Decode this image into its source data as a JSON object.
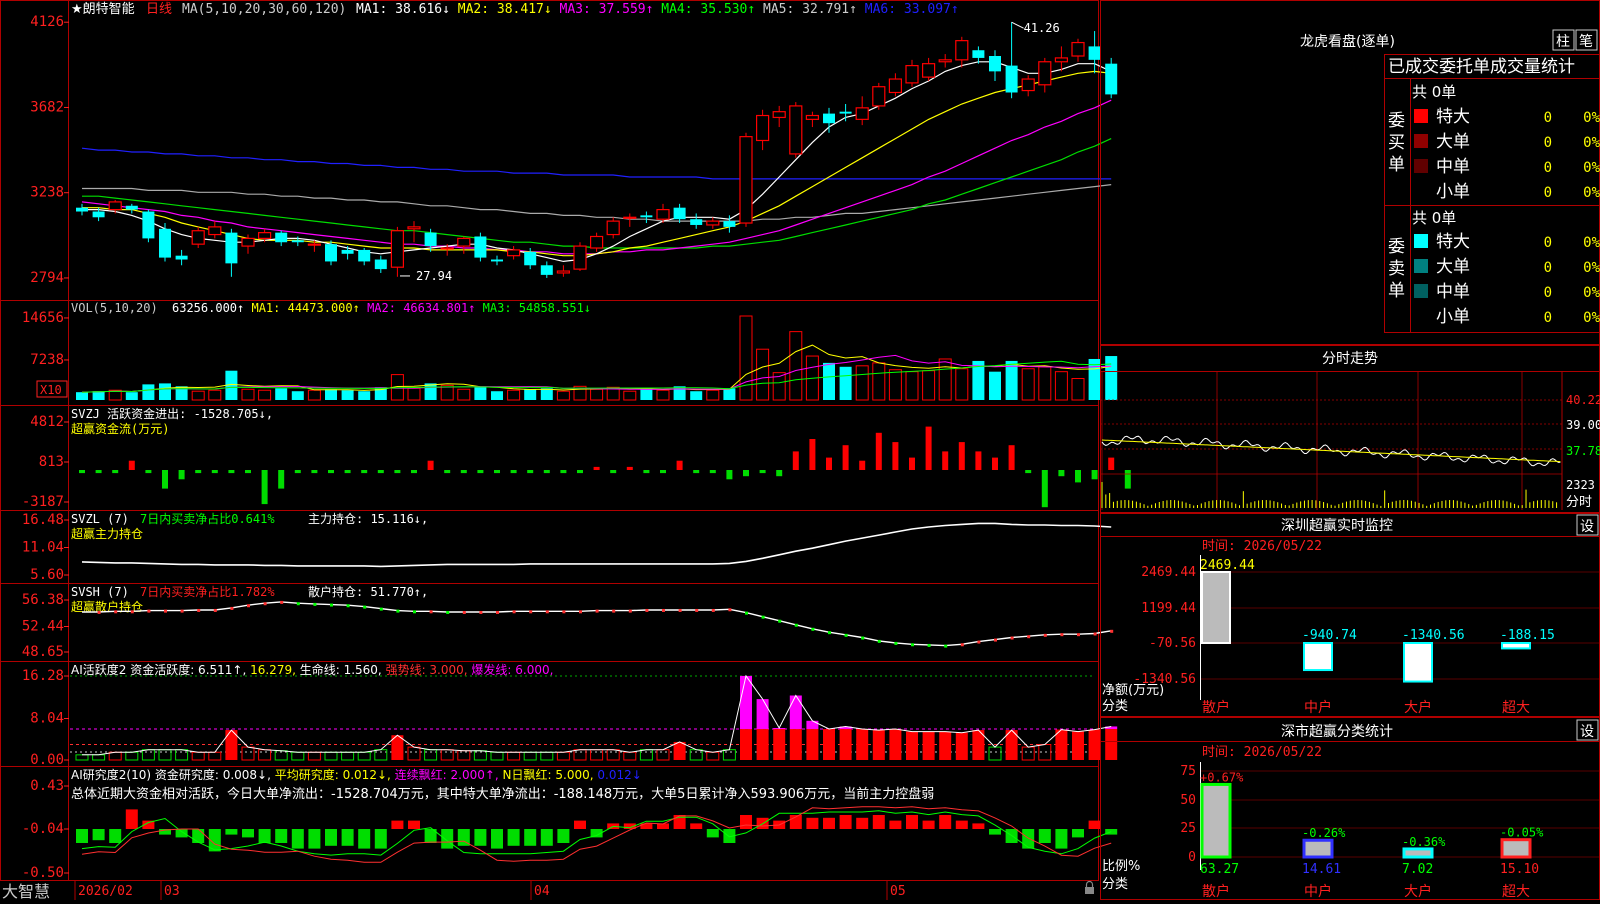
{
  "header": {
    "stock_name": "★朗特智能",
    "period": "日线",
    "ma_label": "MA(5,10,20,30,60,120)",
    "ma": [
      {
        "text": "MA1: 38.616↓",
        "color": "#ffffff"
      },
      {
        "text": "MA2: 38.417↓",
        "color": "#ffff00"
      },
      {
        "text": "MA3: 37.559↑",
        "color": "#ff00ff"
      },
      {
        "text": "MA4: 35.530↑",
        "color": "#00ff00"
      },
      {
        "text": "MA5: 32.791↑",
        "color": "#cccccc"
      },
      {
        "text": "MA6: 33.097↑",
        "color": "#2020ff"
      }
    ],
    "high_label": "41.26",
    "low_label": "27.94"
  },
  "price_axis": [
    "4126",
    "3682",
    "3238",
    "2794"
  ],
  "vol_panel": {
    "title": "VOL(5,10,20)",
    "items": [
      {
        "text": "63256.000↑",
        "color": "#ffffff"
      },
      {
        "text": "MA1: 44473.000↑",
        "color": "#ffff00"
      },
      {
        "text": "MA2: 46634.801↑",
        "color": "#ff00ff"
      },
      {
        "text": "MA3: 54858.551↓",
        "color": "#00ff00"
      }
    ],
    "axis": [
      "14656",
      "7238"
    ],
    "unit": "X10"
  },
  "svzj_panel": {
    "line1": "SVZJ  活跃资金进出: -1528.705↓,",
    "line2": "超赢资金流(万元)",
    "axis": [
      "4812",
      "813",
      "-3187"
    ]
  },
  "svzl_panel": {
    "line1_a": "SVZL (7)",
    "line1_b": "7日内买卖净占比0.641%",
    "line1_c": "主力持仓: 15.116↓,",
    "line2": "超赢主力持仓",
    "axis": [
      "16.48",
      "11.04",
      "5.60"
    ]
  },
  "svsh_panel": {
    "line1_a": "SVSH (7)",
    "line1_b": "7日内买卖净占比1.782%",
    "line1_c": "散户持仓: 51.770↑,",
    "line2": "超赢散户持仓",
    "axis": [
      "56.38",
      "52.44",
      "48.65"
    ]
  },
  "ai_active_panel": {
    "items": [
      {
        "text": "AI活跃度2 资金活跃度: 6.511↑,",
        "color": "#ffffff"
      },
      {
        "text": "16.279,",
        "color": "#ffff00"
      },
      {
        "text": "生命线: 1.560,",
        "color": "#ffffff"
      },
      {
        "text": "强势线: 3.000,",
        "color": "#ff3030"
      },
      {
        "text": "爆发线: 6.000,",
        "color": "#ff00ff"
      }
    ],
    "axis": [
      "16.28",
      "8.04",
      "0.00"
    ]
  },
  "ai_research_panel": {
    "items": [
      {
        "text": "AI研究度2(10) 资金研究度: 0.008↓,",
        "color": "#ffffff"
      },
      {
        "text": "平均研究度: 0.012↓,",
        "color": "#ffff00"
      },
      {
        "text": "连续飘红: 2.000↑,",
        "color": "#ff00ff"
      },
      {
        "text": "N日飘红: 5.000,",
        "color": "#ffff00"
      },
      {
        "text": "0.012↓",
        "color": "#2020ff"
      }
    ],
    "summary": "总体近期大资金相对活跃，今日大单净流出：-1528.704万元，其中特大单净流出：-188.148万元，大单5日累计净入593.906万元，当前主力控盘弱",
    "axis": [
      "0.43",
      "-0.04",
      "-0.50"
    ]
  },
  "bottom_bar": {
    "brand": "大智慧",
    "date_labels": [
      "2026/02",
      "03",
      "04",
      "05"
    ]
  },
  "dragon_tiger": {
    "title": "龙虎看盘(逐单)",
    "btn1": "柱",
    "btn2": "笔",
    "subtitle": "已成交委托单成交量统计",
    "buy_label": "委买单",
    "sell_label": "委卖单",
    "buy_total": "共 0单",
    "sell_total": "共 0单",
    "buy_rows": [
      {
        "label": "特大",
        "count": "0",
        "pct": "0%",
        "color": "#ff0000"
      },
      {
        "label": "大单",
        "count": "0",
        "pct": "0%",
        "color": "#900000"
      },
      {
        "label": "中单",
        "count": "0",
        "pct": "0%",
        "color": "#600000"
      },
      {
        "label": "小单",
        "count": "0",
        "pct": "0%",
        "color": ""
      }
    ],
    "sell_rows": [
      {
        "label": "特大",
        "count": "0",
        "pct": "0%",
        "color": "#00ffff"
      },
      {
        "label": "大单",
        "count": "0",
        "pct": "0%",
        "color": "#008080"
      },
      {
        "label": "中单",
        "count": "0",
        "pct": "0%",
        "color": "#006060"
      },
      {
        "label": "小单",
        "count": "0",
        "pct": "0%",
        "color": ""
      }
    ]
  },
  "intraday": {
    "title": "分时走势",
    "axis": [
      "40.22",
      "39.00",
      "37.78"
    ],
    "vol_label": "2323",
    "bottom_label": "分时"
  },
  "realtime_monitor": {
    "title": "深圳超赢实时监控",
    "settings": "设",
    "time": "时间: 2026/05/22",
    "axis": [
      "2469.44",
      "1199.44",
      "-70.56",
      "-1340.56"
    ],
    "ylabel1": "净额(万元)",
    "ylabel2": "分类",
    "categories": [
      "散户",
      "中户",
      "大户",
      "超大"
    ],
    "values": [
      2469.44,
      -940.74,
      -1340.56,
      -188.15
    ],
    "value_labels": [
      "2469.44",
      "-940.74",
      "-1340.56",
      "-188.15"
    ]
  },
  "class_stats": {
    "title": "深市超赢分类统计",
    "settings": "设",
    "time": "时间: 2026/05/22",
    "axis": [
      "75",
      "50",
      "25",
      "0"
    ],
    "ylabel1": "比例%",
    "ylabel2": "分类",
    "categories": [
      "散户",
      "中户",
      "大户",
      "超大"
    ],
    "values": [
      63.27,
      14.61,
      7.02,
      15.1
    ],
    "value_labels": [
      "63.27",
      "14.61",
      "7.02",
      "15.10"
    ],
    "change_labels": [
      "+0.67%",
      "-0.26%",
      "-0.36%",
      "-0.05%"
    ]
  },
  "colors": {
    "up": "#ff0000",
    "down": "#00ffff",
    "frame": "#b00000",
    "flow_up": "#ff0000",
    "flow_down": "#00dd00"
  },
  "chart_data": {
    "type": "candlestick",
    "x": [
      "2026/02",
      "03",
      "04",
      "05"
    ],
    "candles": [
      [
        31.6,
        31.4,
        31.8,
        31.2
      ],
      [
        31.4,
        31.1,
        31.6,
        30.9
      ],
      [
        31.5,
        31.9,
        32.0,
        31.3
      ],
      [
        31.7,
        31.5,
        31.8,
        31.3
      ],
      [
        31.4,
        30.0,
        31.5,
        29.8
      ],
      [
        30.5,
        29.0,
        30.8,
        28.8
      ],
      [
        29.1,
        28.9,
        29.4,
        28.6
      ],
      [
        29.7,
        30.4,
        30.6,
        29.5
      ],
      [
        30.2,
        30.6,
        30.9,
        30.0
      ],
      [
        30.3,
        28.7,
        30.5,
        28.0
      ],
      [
        29.6,
        30.0,
        30.2,
        29.2
      ],
      [
        30.0,
        30.3,
        30.5,
        29.8
      ],
      [
        30.3,
        29.8,
        30.4,
        29.6
      ],
      [
        29.9,
        29.8,
        30.1,
        29.6
      ],
      [
        29.7,
        29.7,
        29.9,
        29.3
      ],
      [
        29.7,
        28.8,
        29.9,
        28.6
      ],
      [
        29.4,
        29.2,
        29.6,
        28.9
      ],
      [
        29.4,
        28.8,
        29.5,
        28.6
      ],
      [
        28.9,
        28.4,
        29.1,
        28.2
      ],
      [
        28.5,
        30.4,
        30.6,
        28.0
      ],
      [
        30.5,
        30.6,
        30.9,
        29.8
      ],
      [
        30.3,
        29.6,
        30.5,
        29.3
      ],
      [
        29.5,
        29.5,
        29.7,
        29.1
      ],
      [
        29.6,
        30.0,
        30.1,
        29.2
      ],
      [
        30.1,
        29.0,
        30.3,
        28.8
      ],
      [
        28.9,
        28.8,
        29.1,
        28.6
      ],
      [
        29.1,
        29.4,
        29.6,
        28.9
      ],
      [
        29.3,
        28.6,
        29.5,
        28.4
      ],
      [
        28.6,
        28.1,
        28.8,
        27.94
      ],
      [
        28.2,
        28.3,
        28.6,
        28.0
      ],
      [
        28.4,
        29.6,
        29.8,
        28.3
      ],
      [
        29.5,
        30.1,
        30.3,
        29.3
      ],
      [
        30.2,
        30.9,
        31.1,
        30.0
      ],
      [
        31.1,
        31.1,
        31.3,
        30.6
      ],
      [
        31.2,
        31.1,
        31.4,
        30.8
      ],
      [
        31.0,
        31.5,
        31.8,
        30.8
      ],
      [
        31.6,
        31.0,
        31.8,
        30.8
      ],
      [
        31.0,
        30.7,
        31.3,
        30.5
      ],
      [
        30.7,
        30.9,
        31.1,
        30.5
      ],
      [
        30.9,
        30.6,
        31.2,
        30.3
      ],
      [
        30.8,
        35.3,
        35.5,
        30.6
      ],
      [
        35.1,
        36.4,
        36.7,
        34.6
      ],
      [
        36.3,
        36.6,
        36.9,
        35.8
      ],
      [
        34.4,
        36.9,
        37.1,
        34.2
      ],
      [
        36.2,
        36.4,
        36.6,
        35.8
      ],
      [
        36.5,
        36.0,
        36.8,
        35.5
      ],
      [
        36.6,
        36.5,
        37.0,
        36.1
      ],
      [
        36.2,
        36.8,
        37.4,
        35.9
      ],
      [
        36.9,
        37.9,
        38.1,
        36.7
      ],
      [
        37.6,
        38.3,
        38.6,
        37.4
      ],
      [
        38.1,
        39.0,
        39.3,
        37.9
      ],
      [
        38.4,
        39.1,
        39.4,
        38.2
      ],
      [
        39.2,
        39.3,
        39.6,
        38.9
      ],
      [
        39.3,
        40.3,
        40.5,
        38.9
      ],
      [
        39.8,
        39.4,
        40.0,
        39.1
      ],
      [
        39.5,
        38.7,
        39.8,
        38.2
      ],
      [
        39.0,
        37.6,
        41.26,
        37.3
      ],
      [
        37.7,
        38.3,
        38.5,
        37.4
      ],
      [
        38.0,
        39.2,
        39.4,
        37.6
      ],
      [
        39.2,
        39.4,
        40.0,
        38.7
      ],
      [
        39.5,
        40.2,
        40.4,
        39.2
      ],
      [
        40.0,
        39.3,
        40.8,
        38.6
      ],
      [
        39.1,
        37.5,
        39.4,
        37.3
      ]
    ],
    "ma": {
      "ma5": [
        31.5,
        31.5,
        31.4,
        31.2,
        30.9,
        30.5,
        30.2,
        30.0,
        29.9,
        29.8,
        29.8,
        29.9,
        30.0,
        30.0,
        29.9,
        29.7,
        29.5,
        29.3,
        29.2,
        29.3,
        29.4,
        29.5,
        29.6,
        29.7,
        29.7,
        29.5,
        29.4,
        29.2,
        29.0,
        28.8,
        28.9,
        29.2,
        29.6,
        30.1,
        30.5,
        30.9,
        31.1,
        31.1,
        31.1,
        31.0,
        31.5,
        32.3,
        33.2,
        34.1,
        35.0,
        35.8,
        36.3,
        36.5,
        36.9,
        37.3,
        37.8,
        38.2,
        38.7,
        39.0,
        39.2,
        39.2,
        38.9,
        38.6,
        38.6,
        38.8,
        39.1,
        39.1,
        38.7
      ],
      "ma10": [
        31.6,
        31.6,
        31.5,
        31.5,
        31.3,
        31.1,
        30.8,
        30.6,
        30.4,
        30.2,
        30.0,
        29.9,
        29.9,
        29.9,
        29.8,
        29.8,
        29.7,
        29.6,
        29.5,
        29.5,
        29.5,
        29.4,
        29.4,
        29.4,
        29.4,
        29.4,
        29.3,
        29.3,
        29.2,
        29.1,
        29.1,
        29.2,
        29.3,
        29.5,
        29.6,
        29.8,
        30.0,
        30.2,
        30.4,
        30.6,
        30.9,
        31.3,
        31.7,
        32.2,
        32.7,
        33.2,
        33.7,
        34.2,
        34.7,
        35.2,
        35.7,
        36.2,
        36.6,
        37.0,
        37.3,
        37.6,
        37.8,
        38.0,
        38.2,
        38.4,
        38.6,
        38.7,
        38.6
      ],
      "ma20": [
        31.9,
        31.8,
        31.7,
        31.6,
        31.5,
        31.4,
        31.2,
        31.1,
        30.9,
        30.8,
        30.6,
        30.5,
        30.4,
        30.3,
        30.2,
        30.1,
        30.0,
        29.9,
        29.8,
        29.7,
        29.7,
        29.6,
        29.6,
        29.5,
        29.5,
        29.4,
        29.4,
        29.3,
        29.3,
        29.2,
        29.2,
        29.2,
        29.3,
        29.3,
        29.4,
        29.4,
        29.5,
        29.6,
        29.7,
        29.8,
        30.0,
        30.2,
        30.4,
        30.7,
        31.0,
        31.3,
        31.6,
        31.9,
        32.2,
        32.5,
        32.8,
        33.2,
        33.5,
        33.9,
        34.3,
        34.7,
        35.1,
        35.4,
        35.8,
        36.1,
        36.5,
        36.8,
        37.2
      ],
      "ma30": [
        32.2,
        32.2,
        32.1,
        32.0,
        31.9,
        31.8,
        31.7,
        31.6,
        31.5,
        31.4,
        31.3,
        31.2,
        31.1,
        31.0,
        30.9,
        30.8,
        30.7,
        30.6,
        30.5,
        30.4,
        30.4,
        30.3,
        30.2,
        30.1,
        30.0,
        29.9,
        29.8,
        29.8,
        29.7,
        29.6,
        29.6,
        29.5,
        29.5,
        29.5,
        29.5,
        29.5,
        29.5,
        29.5,
        29.6,
        29.6,
        29.7,
        29.8,
        29.9,
        30.1,
        30.3,
        30.5,
        30.7,
        30.9,
        31.1,
        31.3,
        31.5,
        31.8,
        32.0,
        32.3,
        32.6,
        32.9,
        33.2,
        33.5,
        33.8,
        34.1,
        34.5,
        34.8,
        35.2
      ],
      "ma60": [
        32.6,
        32.6,
        32.6,
        32.6,
        32.5,
        32.5,
        32.5,
        32.4,
        32.4,
        32.4,
        32.3,
        32.3,
        32.2,
        32.2,
        32.1,
        32.1,
        32.0,
        32.0,
        31.9,
        31.9,
        31.8,
        31.7,
        31.7,
        31.6,
        31.5,
        31.5,
        31.4,
        31.3,
        31.3,
        31.2,
        31.2,
        31.1,
        31.1,
        31.0,
        31.0,
        30.9,
        30.9,
        30.9,
        30.9,
        30.9,
        30.9,
        31.0,
        31.0,
        31.1,
        31.1,
        31.2,
        31.3,
        31.3,
        31.4,
        31.5,
        31.6,
        31.7,
        31.8,
        31.9,
        32.0,
        32.1,
        32.2,
        32.3,
        32.4,
        32.5,
        32.6,
        32.7,
        32.8
      ],
      "ma120": [
        34.7,
        34.6,
        34.6,
        34.5,
        34.5,
        34.4,
        34.4,
        34.3,
        34.3,
        34.2,
        34.2,
        34.1,
        34.1,
        34.0,
        34.0,
        33.9,
        33.9,
        33.8,
        33.8,
        33.7,
        33.7,
        33.6,
        33.6,
        33.5,
        33.5,
        33.5,
        33.4,
        33.4,
        33.4,
        33.3,
        33.3,
        33.3,
        33.3,
        33.2,
        33.2,
        33.2,
        33.2,
        33.2,
        33.1,
        33.1,
        33.1,
        33.1,
        33.1,
        33.1,
        33.1,
        33.1,
        33.1,
        33.1,
        33.1,
        33.1,
        33.1,
        33.1,
        33.1,
        33.1,
        33.1,
        33.1,
        33.1,
        33.1,
        33.1,
        33.1,
        33.1,
        33.1,
        33.1
      ]
    },
    "volume": [
      8,
      9,
      10,
      8,
      16,
      17,
      14,
      9,
      10,
      30,
      11,
      10,
      12,
      9,
      10,
      11,
      10,
      9,
      13,
      26,
      12,
      17,
      15,
      11,
      13,
      9,
      10,
      11,
      12,
      9,
      14,
      11,
      13,
      9,
      11,
      10,
      14,
      9,
      10,
      12,
      86,
      52,
      28,
      70,
      45,
      38,
      34,
      35,
      38,
      31,
      29,
      30,
      42,
      32,
      40,
      29,
      40,
      32,
      34,
      29,
      22,
      42,
      45
    ],
    "flow": [
      -5,
      -5,
      -5,
      15,
      -5,
      -30,
      -15,
      -5,
      -5,
      -5,
      -5,
      -55,
      -30,
      -5,
      -5,
      -5,
      -5,
      -5,
      -5,
      -5,
      -5,
      15,
      -5,
      -5,
      -5,
      -5,
      -5,
      -5,
      -5,
      -5,
      -5,
      5,
      -5,
      5,
      -5,
      -5,
      15,
      -5,
      -5,
      -15,
      -10,
      -5,
      -10,
      30,
      50,
      20,
      40,
      15,
      60,
      45,
      20,
      70,
      30,
      45,
      30,
      20,
      40,
      -5,
      -60,
      -10,
      -20,
      -15,
      20,
      -30
    ],
    "svzl": [
      8.2,
      8.1,
      8.0,
      8.0,
      7.9,
      7.8,
      7.7,
      7.7,
      7.6,
      7.6,
      7.6,
      7.5,
      7.5,
      7.4,
      7.4,
      7.4,
      7.4,
      7.4,
      7.3,
      7.4,
      7.5,
      7.6,
      7.7,
      7.7,
      7.7,
      7.7,
      7.7,
      7.8,
      7.8,
      7.8,
      7.8,
      7.8,
      7.8,
      7.8,
      7.8,
      7.8,
      7.8,
      7.8,
      7.8,
      7.9,
      8.3,
      8.9,
      9.6,
      10.3,
      10.9,
      11.6,
      12.3,
      12.9,
      13.5,
      14.1,
      14.7,
      15.1,
      15.4,
      15.6,
      15.8,
      15.8,
      15.6,
      15.5,
      15.5,
      15.4,
      15.4,
      15.3,
      15.1
    ],
    "svsh": [
      54.6,
      54.6,
      54.7,
      54.7,
      54.8,
      54.8,
      54.8,
      54.9,
      54.9,
      55.2,
      55.6,
      55.9,
      56.1,
      55.9,
      55.8,
      55.7,
      55.6,
      55.4,
      55.1,
      54.8,
      54.7,
      54.7,
      54.6,
      54.6,
      54.6,
      54.6,
      54.7,
      54.7,
      54.7,
      54.7,
      54.7,
      54.8,
      54.8,
      54.8,
      54.9,
      54.9,
      54.9,
      54.9,
      54.9,
      55.0,
      54.5,
      53.9,
      53.3,
      52.7,
      52.1,
      51.6,
      51.2,
      50.8,
      50.3,
      50.0,
      49.8,
      49.7,
      49.6,
      49.8,
      50.2,
      50.5,
      50.8,
      51.0,
      51.2,
      51.3,
      51.3,
      51.4,
      51.8
    ],
    "ai_active": [
      1,
      1,
      1.5,
      1.5,
      2,
      2,
      2,
      1.5,
      1.5,
      5.8,
      2.5,
      2,
      1.8,
      1.5,
      1.5,
      1.5,
      1.5,
      1.5,
      2,
      4.8,
      2.5,
      2,
      2,
      1.8,
      1.8,
      1.5,
      1.5,
      1.5,
      1.5,
      1.5,
      2,
      2,
      2,
      1.5,
      2,
      2,
      3.5,
      2,
      1.5,
      2,
      16.3,
      11.8,
      6.2,
      12.5,
      7.6,
      6,
      6.5,
      6,
      5.8,
      6,
      5.5,
      5.5,
      5.5,
      5.3,
      5.8,
      2.5,
      5.8,
      2.5,
      3,
      5.9,
      5.5,
      5.9,
      6.5
    ],
    "ai_research": [
      -0.05,
      -0.04,
      -0.05,
      0.07,
      0.03,
      -0.02,
      -0.03,
      -0.05,
      -0.08,
      -0.02,
      -0.03,
      -0.05,
      -0.05,
      -0.07,
      -0.07,
      -0.06,
      -0.06,
      -0.07,
      -0.07,
      0.03,
      0.03,
      -0.05,
      -0.07,
      -0.06,
      -0.06,
      -0.07,
      -0.06,
      -0.06,
      -0.06,
      -0.05,
      0.03,
      -0.03,
      0.02,
      0.02,
      0.02,
      0.02,
      0.05,
      0.02,
      -0.03,
      -0.05,
      0.05,
      0.04,
      0.03,
      0.05,
      0.04,
      0.04,
      0.05,
      0.04,
      0.05,
      0.03,
      0.05,
      0.03,
      0.05,
      0.03,
      0.02,
      -0.02,
      -0.05,
      -0.07,
      -0.05,
      -0.07,
      -0.03,
      0.03,
      -0.02
    ]
  }
}
